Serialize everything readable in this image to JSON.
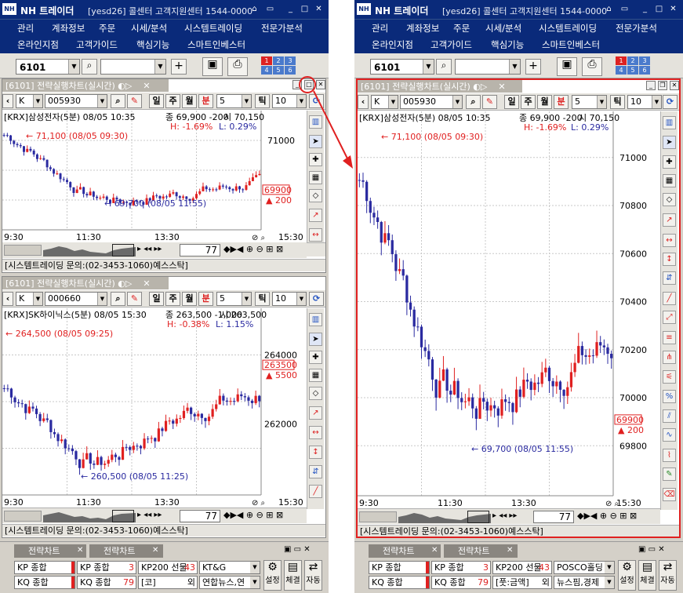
{
  "app": {
    "title": "NH 트레이더",
    "user": "[yesd26]",
    "center": "콜센터 고객지원센터 1544-0000",
    "title_buttons": [
      "⌂",
      "▭",
      "_",
      "□",
      "✕"
    ]
  },
  "menu": {
    "row1": [
      "관리",
      "계좌정보",
      "주문",
      "시세/분석",
      "시스템트레이딩",
      "전문가분석"
    ],
    "row2": [
      "온라인지점",
      "고객가이드",
      "핵심기능",
      "스마트인베스터"
    ]
  },
  "toolbar": {
    "screen_no": "6101",
    "search_placeholder": "",
    "plus": "+",
    "grid_nums": [
      "1",
      "2",
      "3",
      "4",
      "5",
      "6"
    ]
  },
  "chart_window": {
    "title": "[6101] 전략실행차트(실시간)",
    "suffix": "◐▷",
    "market": "K",
    "period_buttons": [
      "일",
      "주",
      "월",
      "분",
      "틱"
    ],
    "interval": "5",
    "tick_count": "10",
    "nav_value": "77",
    "status": "[시스템트레이딩 문의:(02-3453-1060)예스스탁]"
  },
  "samsung": {
    "code": "005930",
    "info": "[KRX]삼성전자(5분) 08/05 10:35",
    "change": "종 69,900 -200",
    "open_label": "시 70,150",
    "h_pct": "H: -1.69%",
    "l_pct": "L: 0.29%",
    "high_note": "71,100 (08/05 09:30)",
    "low_note": "69,700 (08/05 11:55)",
    "last_price": "69900",
    "last_change": "▲ 200",
    "times": [
      "9:30",
      "11:30",
      "13:30",
      "15:30"
    ],
    "small_y": [
      "71000"
    ],
    "big_y": [
      "71000",
      "70800",
      "70600",
      "70400",
      "70200",
      "70000",
      "69800"
    ]
  },
  "hynix": {
    "code": "000660",
    "info": "[KRX]SK하이닉스(5분) 08/05 15:30",
    "change": "종 263,500 -1,000",
    "open_label": "시 263,500",
    "h_pct": "H: -0.38%",
    "l_pct": "L: 1.15%",
    "high_note": "264,500 (08/05 09:25)",
    "low_note": "260,500 (08/05 11:25)",
    "last_price": "263500",
    "last_change": "▲ 5500",
    "times": [
      "9:30",
      "11:30",
      "13:30",
      "15:30"
    ],
    "y": [
      "264000",
      "262000"
    ]
  },
  "bottom": {
    "tabs": [
      "전략차트",
      "전략차트"
    ],
    "left": {
      "row1": [
        "KP 종합",
        "KP 종합",
        "KP200 선물",
        "KT&G"
      ],
      "row2": [
        "KQ 종합",
        "KQ 종합",
        "[코]",
        "연합뉴스,연"
      ],
      "row1_vals": [
        "3",
        "43"
      ],
      "row2_vals": [
        "79",
        "외"
      ]
    },
    "right": {
      "row1": [
        "KP 종합",
        "KP 종합",
        "KP200 선물",
        "POSCO홀딩"
      ],
      "row2": [
        "KQ 종합",
        "KQ 종합",
        "[풋:금액]",
        "뉴스핌,경제"
      ],
      "row1_vals": [
        "3",
        "43"
      ],
      "row2_vals": [
        "79",
        "외"
      ]
    },
    "big_buttons": [
      "설정",
      "체결",
      "자동"
    ]
  },
  "colors": {
    "titlebar": "#0a2a7a",
    "up": "#e02020",
    "down": "#2a2aa0",
    "highlight": "#e02020"
  }
}
